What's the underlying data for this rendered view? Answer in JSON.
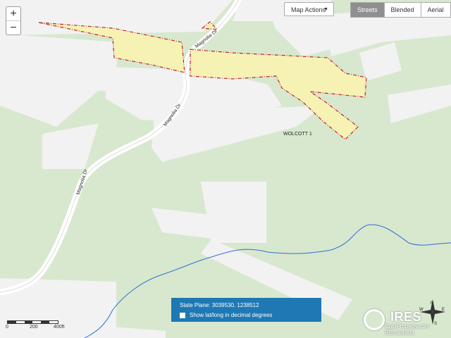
{
  "zoom": {
    "in_label": "+",
    "out_label": "−"
  },
  "toolbar": {
    "map_actions_label": "Map Actions",
    "map_actions_caret": "▼"
  },
  "basemap": {
    "options": [
      "Streets",
      "Blended",
      "Aerial"
    ],
    "selected": "Streets"
  },
  "roads": [
    {
      "label": "Magnolia Dr"
    },
    {
      "label": "Magnolia Dr"
    },
    {
      "label": "Magnolia Dr"
    }
  ],
  "parcel": {
    "label": "WOLCOTT 1"
  },
  "coords_panel": {
    "state_plane": "State Plane: 3039530, 1238512",
    "toggle_label": "Show lat/long in decimal degrees"
  },
  "scale": {
    "labels": [
      "0",
      "200",
      "400ft"
    ]
  },
  "watermark": {
    "brand": "IRES",
    "line1": "ColoProperty.com",
    "line2": "REcolorado"
  },
  "compass": {
    "letters": [
      "N",
      "E",
      "W",
      "S"
    ]
  },
  "colors": {
    "land": "#d8e8cf",
    "road": "#ffffff",
    "parcel_fill": "#f6f2b3",
    "parcel_outline": "#c0212c",
    "stream": "#2e6fd0",
    "panel": "#1e78b4"
  }
}
